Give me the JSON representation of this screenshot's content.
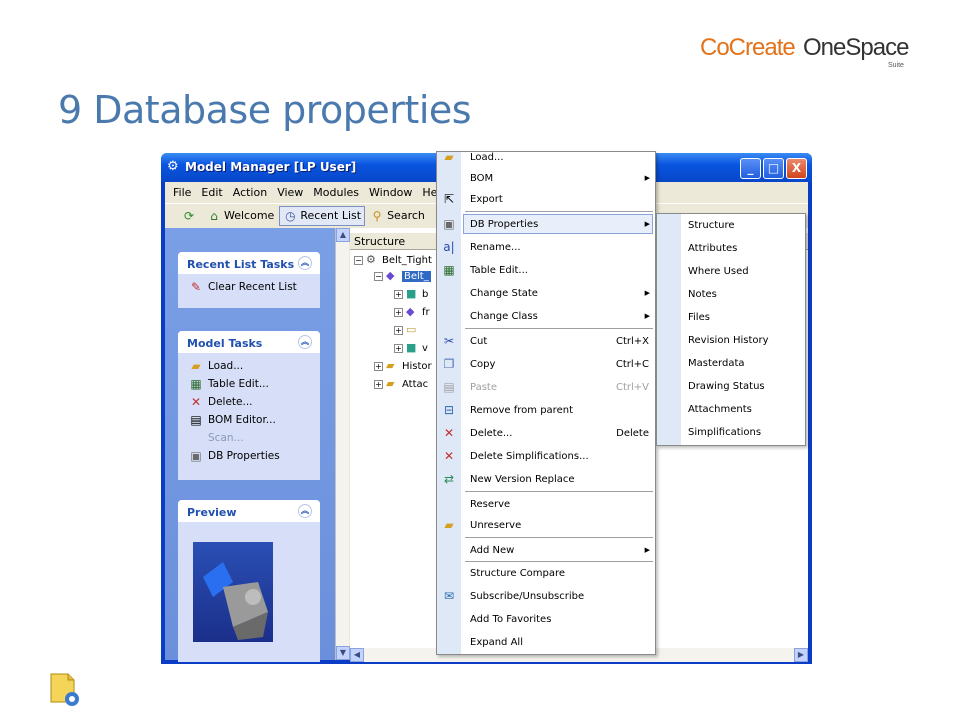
{
  "brand": {
    "part1": "CoCreate",
    "part2": "OneSpace",
    "suite": "Suite"
  },
  "slide_title": "9 Database properties",
  "window": {
    "title": "Model Manager [LP User]",
    "controls": {
      "minimize": "_",
      "maximize": "□",
      "close": "X"
    },
    "menubar": [
      "File",
      "Edit",
      "Action",
      "View",
      "Modules",
      "Window",
      "Help"
    ],
    "toolbar": {
      "welcome": "Welcome",
      "recent": "Recent List",
      "search": "Search"
    },
    "recent_tasks": {
      "title": "Recent List Tasks",
      "items": [
        "Clear Recent List"
      ]
    },
    "model_tasks": {
      "title": "Model Tasks",
      "items": [
        "Load...",
        "Table Edit...",
        "Delete...",
        "BOM Editor...",
        "Scan...",
        "DB Properties"
      ]
    },
    "preview": {
      "title": "Preview"
    },
    "tree": {
      "header": "Structure",
      "nodes": [
        "Belt_Tight",
        "Belt_",
        "b",
        "fr",
        "",
        "v",
        "Histor",
        "Attac"
      ]
    }
  },
  "context_menu": {
    "items": [
      {
        "label": "Load...",
        "shortcut": "",
        "arrow": false,
        "disabled": false
      },
      {
        "label": "BOM",
        "shortcut": "",
        "arrow": true,
        "disabled": false
      },
      {
        "label": "Export",
        "shortcut": "",
        "arrow": false,
        "disabled": false
      },
      {
        "label": "DB Properties",
        "shortcut": "",
        "arrow": true,
        "disabled": false
      },
      {
        "label": "Rename...",
        "shortcut": "",
        "arrow": false,
        "disabled": false
      },
      {
        "label": "Table Edit...",
        "shortcut": "",
        "arrow": false,
        "disabled": false
      },
      {
        "label": "Change State",
        "shortcut": "",
        "arrow": true,
        "disabled": false
      },
      {
        "label": "Change Class",
        "shortcut": "",
        "arrow": true,
        "disabled": false
      },
      {
        "label": "Cut",
        "shortcut": "Ctrl+X",
        "arrow": false,
        "disabled": false
      },
      {
        "label": "Copy",
        "shortcut": "Ctrl+C",
        "arrow": false,
        "disabled": false
      },
      {
        "label": "Paste",
        "shortcut": "Ctrl+V",
        "arrow": false,
        "disabled": true
      },
      {
        "label": "Remove from parent",
        "shortcut": "",
        "arrow": false,
        "disabled": false
      },
      {
        "label": "Delete...",
        "shortcut": "Delete",
        "arrow": false,
        "disabled": false
      },
      {
        "label": "Delete Simplifications...",
        "shortcut": "",
        "arrow": false,
        "disabled": false
      },
      {
        "label": "New Version Replace",
        "shortcut": "",
        "arrow": false,
        "disabled": false
      },
      {
        "label": "Reserve",
        "shortcut": "",
        "arrow": false,
        "disabled": false
      },
      {
        "label": "Unreserve",
        "shortcut": "",
        "arrow": false,
        "disabled": false
      },
      {
        "label": "Add New",
        "shortcut": "",
        "arrow": true,
        "disabled": false
      },
      {
        "label": "Structure Compare",
        "shortcut": "",
        "arrow": false,
        "disabled": false
      },
      {
        "label": "Subscribe/Unsubscribe",
        "shortcut": "",
        "arrow": false,
        "disabled": false
      },
      {
        "label": "Add To Favorites",
        "shortcut": "",
        "arrow": false,
        "disabled": false
      },
      {
        "label": "Expand All",
        "shortcut": "",
        "arrow": false,
        "disabled": false
      }
    ]
  },
  "db_properties_submenu": [
    "Structure",
    "Attributes",
    "Where Used",
    "Notes",
    "Files",
    "Revision History",
    "Masterdata",
    "Drawing Status",
    "Attachments",
    "Simplifications"
  ],
  "colors": {
    "title_blue": "#4a79ad",
    "brand_orange": "#e2731a",
    "xp_blue": "#0a55e0"
  }
}
